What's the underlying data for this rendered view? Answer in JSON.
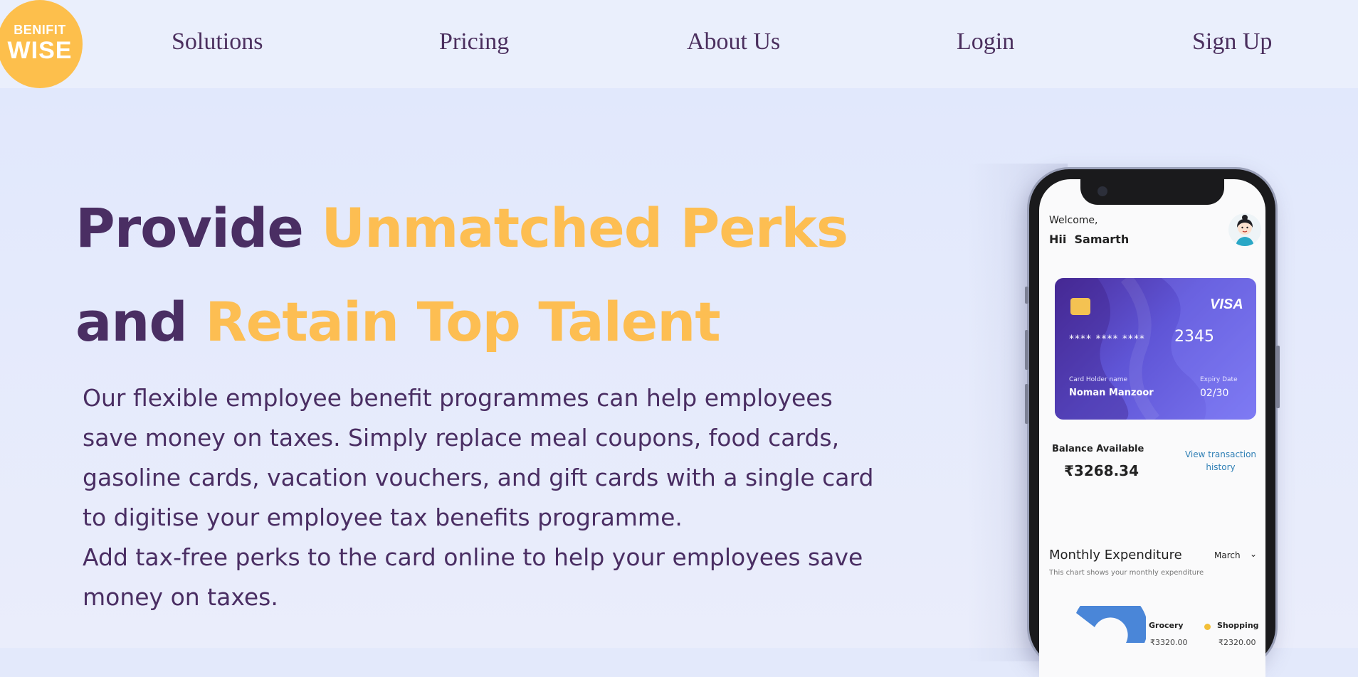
{
  "brand": {
    "line1": "BENIFIT",
    "line2": "WISE",
    "color": "#fdbf4c"
  },
  "nav": {
    "links": [
      {
        "label": "Solutions"
      },
      {
        "label": "Pricing"
      },
      {
        "label": "About Us"
      },
      {
        "label": "Login"
      },
      {
        "label": "Sign Up"
      }
    ]
  },
  "hero": {
    "headline": {
      "line1_dark": "Provide",
      "line1_gold": "Unmatched Perks",
      "line2_dark": "and",
      "line2_gold": "Retain Top Talent"
    },
    "paragraph1": "Our flexible employee benefit programmes can help employees save money on taxes. Simply replace meal coupons, food cards, gasoline cards, vacation vouchers, and gift cards with a single card to digitise your employee tax benefits programme.",
    "paragraph2": "Add tax-free perks to the card online to help your employees save money on taxes.",
    "colors": {
      "dark": "#4a2e63",
      "gold": "#fdbe52"
    }
  },
  "phone_app": {
    "welcome": "Welcome,",
    "greeting": "Hii  Samarth",
    "card": {
      "brand": "VISA",
      "masked": "**** **** ****",
      "last4": "2345",
      "holder_label": "Card Holder name",
      "holder": "Noman Manzoor",
      "expiry_label": "Expiry Date",
      "expiry": "02/30"
    },
    "balance_label": "Balance Available",
    "balance": "₹3268.34",
    "transactions_link": "View transaction history",
    "expenditure": {
      "title": "Monthly Expenditure",
      "subtitle": "This chart shows your monthly expenditure",
      "month": "March",
      "legend": [
        {
          "name": "Grocery",
          "value": "₹3320.00",
          "color": "#4a86d8"
        },
        {
          "name": "Shopping",
          "value": "₹2320.00",
          "color": "#f3bf37"
        }
      ]
    }
  }
}
